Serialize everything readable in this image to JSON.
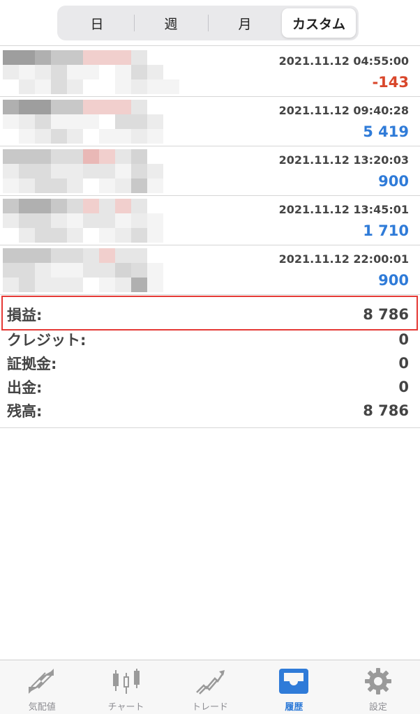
{
  "period_selector": {
    "options": [
      "日",
      "週",
      "月",
      "カスタム"
    ],
    "selected": "カスタム"
  },
  "deals": [
    {
      "time": "2021.11.12 04:55:00",
      "profit": "-143",
      "type": "negative"
    },
    {
      "time": "2021.11.12 09:40:28",
      "profit": "5 419",
      "type": "positive"
    },
    {
      "time": "2021.11.12 13:20:03",
      "profit": "900",
      "type": "positive"
    },
    {
      "time": "2021.11.12 13:45:01",
      "profit": "1 710",
      "type": "positive"
    },
    {
      "time": "2021.11.12 22:00:01",
      "profit": "900",
      "type": "positive"
    }
  ],
  "summary": {
    "profit_label": "損益:",
    "profit_value": "8 786",
    "credit_label": "クレジット:",
    "credit_value": "0",
    "deposit_label": "証拠金:",
    "deposit_value": "0",
    "withdrawal_label": "出金:",
    "withdrawal_value": "0",
    "balance_label": "残高:",
    "balance_value": "8 786"
  },
  "tabs": [
    {
      "label": "気配値",
      "icon": "quotes-icon"
    },
    {
      "label": "チャート",
      "icon": "chart-icon"
    },
    {
      "label": "トレード",
      "icon": "trade-icon"
    },
    {
      "label": "履歴",
      "icon": "history-icon"
    },
    {
      "label": "設定",
      "icon": "settings-icon"
    }
  ],
  "active_tab": "履歴",
  "colors": {
    "negative": "#d9472b",
    "positive": "#2f7bd8",
    "highlight": "#e53935",
    "active_tab": "#2f7bd8"
  }
}
